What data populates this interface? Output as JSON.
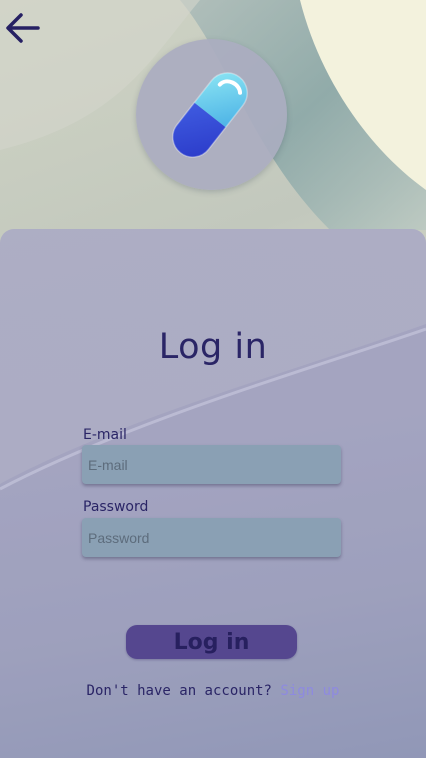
{
  "header": {
    "back_icon": "arrow-left-icon",
    "logo_icon": "pill-capsule-icon"
  },
  "form": {
    "title": "Log in",
    "email_label": "E-mail",
    "email_placeholder": "E-mail",
    "email_value": "",
    "password_label": "Password",
    "password_placeholder": "Password",
    "password_value": "",
    "submit_label": "Log in"
  },
  "footer": {
    "prompt": "Don't have an account?",
    "signup_link": "Sign up"
  },
  "colors": {
    "primary_text": "#2a2566",
    "button_bg": "#55478f",
    "input_bg": "#8aa0b4",
    "link": "#8e8ae0",
    "card_bg": "#acacc4"
  }
}
